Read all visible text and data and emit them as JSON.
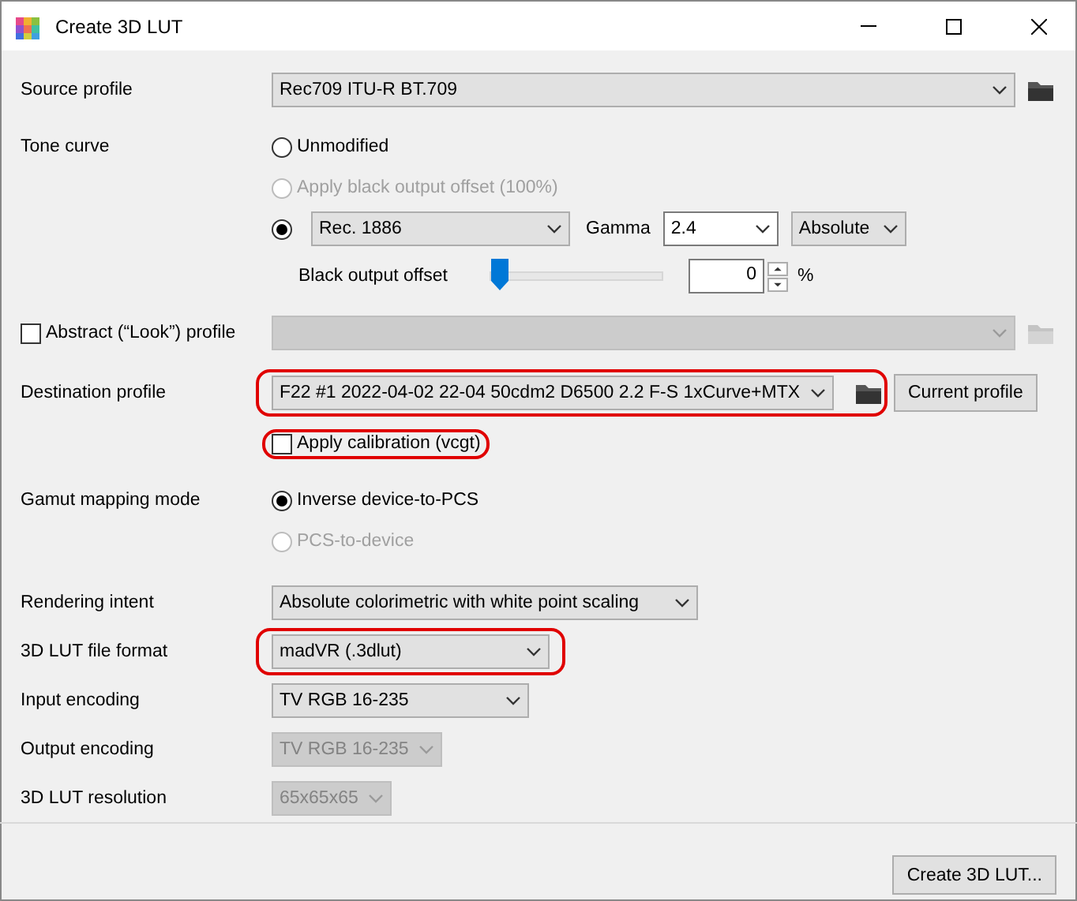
{
  "window": {
    "title": "Create 3D LUT"
  },
  "source_profile": {
    "label": "Source profile",
    "value": "Rec709 ITU-R BT.709"
  },
  "tone_curve": {
    "label": "Tone curve",
    "options": [
      {
        "label": "Unmodified",
        "selected": false,
        "disabled": false
      },
      {
        "label": "Apply black output offset (100%)",
        "selected": false,
        "disabled": true
      }
    ],
    "custom": {
      "selected": true,
      "curve": "Rec. 1886",
      "gamma_label": "Gamma",
      "gamma": "2.4",
      "mode": "Absolute"
    },
    "black_offset": {
      "label": "Black output offset",
      "level": 0,
      "value": "0",
      "unit": "%"
    }
  },
  "abstract_profile": {
    "label": "Abstract (“Look”) profile",
    "checked": false,
    "disabled": true
  },
  "destination_profile": {
    "label": "Destination profile",
    "value": "F22 #1 2022-04-02 22-04 50cdm2 D6500 2.2 F-S 1xCurve+MTX",
    "highlighted": true,
    "button": "Current profile"
  },
  "apply_calibration": {
    "label": "Apply calibration (vcgt)",
    "checked": false,
    "highlighted": true
  },
  "gamut_mapping": {
    "label": "Gamut mapping mode",
    "options": [
      {
        "label": "Inverse device-to-PCS",
        "selected": true,
        "disabled": false
      },
      {
        "label": "PCS-to-device",
        "selected": false,
        "disabled": true
      }
    ]
  },
  "settings": [
    {
      "label": "Rendering intent",
      "value": "Absolute colorimetric with white point scaling",
      "disabled": false,
      "highlighted": false
    },
    {
      "label": "3D LUT file format",
      "value": "madVR (.3dlut)",
      "disabled": false,
      "highlighted": true
    },
    {
      "label": "Input encoding",
      "value": "TV RGB 16-235",
      "disabled": false,
      "highlighted": false
    },
    {
      "label": "Output encoding",
      "value": "TV RGB 16-235",
      "disabled": true,
      "highlighted": false
    },
    {
      "label": "3D LUT resolution",
      "value": "65x65x65",
      "disabled": true,
      "highlighted": false
    }
  ],
  "create_button": "Create 3D LUT..."
}
